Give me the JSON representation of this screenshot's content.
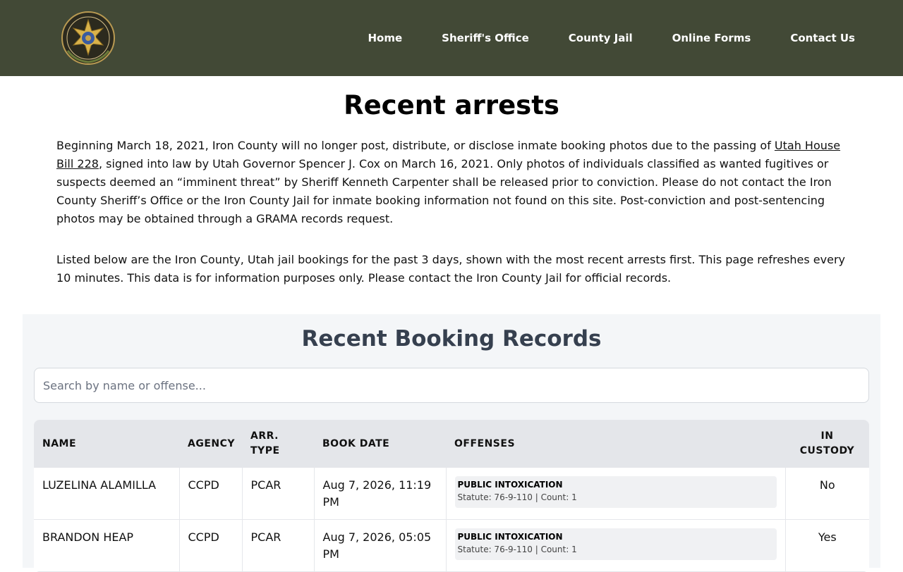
{
  "header": {
    "logo_text": "IRON COUNTY SHERIFF",
    "nav": [
      "Home",
      "Sheriff's Office",
      "County Jail",
      "Online Forms",
      "Contact Us"
    ],
    "background": "#424936"
  },
  "page": {
    "title": "Recent arrests",
    "intro": {
      "p1_before": "Beginning March 18, 2021, Iron County will no longer post, distribute, or disclose inmate booking photos due to the passing of ",
      "p1_link": "Utah House Bill 228",
      "p1_after": ", signed into law by Utah Governor Spencer J. Cox on March 16, 2021. Only photos of individuals classified as wanted fugitives or suspects deemed an “imminent threat” by Sheriff Kenneth Carpenter shall be released prior to conviction. Please do not contact the Iron County Sheriff’s Office or the Iron County Jail for inmate booking information not found on this site. Post-conviction and post-sentencing photos may be obtained through a GRAMA records request.",
      "p2": "Listed below are the Iron County, Utah jail bookings for the past 3 days, shown with the most recent arrests first. This page refreshes every 10 minutes. This data is for information purposes only. Please contact the Iron County Jail for official records."
    }
  },
  "booking": {
    "heading": "Recent Booking Records",
    "search_placeholder": "Search by name or offense...",
    "columns": {
      "name": "NAME",
      "agency": "AGENCY",
      "arr_type": "ARR. TYPE",
      "book_date": "BOOK DATE",
      "offenses": "OFFENSES",
      "in_custody": "IN CUSTODY"
    },
    "rows": [
      {
        "name": "LUZELINA ALAMILLA",
        "agency": "CCPD",
        "arr_type": "PCAR",
        "book_date": "Aug 7, 2026, 11:19 PM",
        "offense_title": "PUBLIC INTOXICATION",
        "offense_meta": "Statute: 76-9-110 | Count: 1",
        "in_custody": "No"
      },
      {
        "name": "BRANDON HEAP",
        "agency": "CCPD",
        "arr_type": "PCAR",
        "book_date": "Aug 7, 2026, 05:05 PM",
        "offense_title": "PUBLIC INTOXICATION",
        "offense_meta": "Statute: 76-9-110 | Count: 1",
        "in_custody": "Yes"
      }
    ]
  }
}
